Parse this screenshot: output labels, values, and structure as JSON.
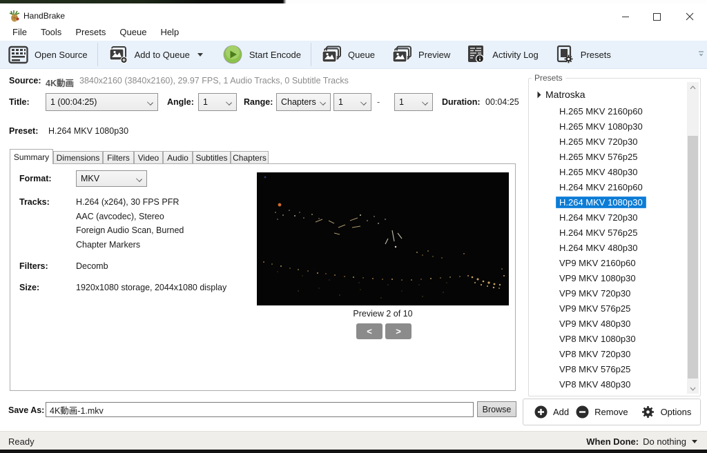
{
  "window": {
    "title": "HandBrake",
    "minimize": "minimize",
    "maximize": "maximize",
    "close": "close"
  },
  "menu": {
    "items": [
      {
        "label": "File"
      },
      {
        "label": "Tools"
      },
      {
        "label": "Presets"
      },
      {
        "label": "Queue"
      },
      {
        "label": "Help"
      }
    ]
  },
  "toolbar": {
    "open_source": "Open Source",
    "add_to_queue": "Add to Queue",
    "start_encode": "Start Encode",
    "queue": "Queue",
    "preview": "Preview",
    "activity_log": "Activity Log",
    "presets": "Presets"
  },
  "source_row": {
    "label": "Source:",
    "name": "4K動画",
    "details": "3840x2160 (3840x2160), 29.97 FPS, 1 Audio Tracks, 0 Subtitle Tracks"
  },
  "title_row": {
    "title_label": "Title:",
    "title_value": "1 (00:04:25)",
    "angle_label": "Angle:",
    "angle_value": "1",
    "range_label": "Range:",
    "range_type": "Chapters",
    "range_from": "1",
    "range_dash": "-",
    "range_to": "1",
    "duration_label": "Duration:",
    "duration_value": "00:04:25"
  },
  "preset_row": {
    "label": "Preset:",
    "value": "H.264 MKV 1080p30"
  },
  "tabs": [
    {
      "label": "Summary"
    },
    {
      "label": "Dimensions"
    },
    {
      "label": "Filters"
    },
    {
      "label": "Video"
    },
    {
      "label": "Audio"
    },
    {
      "label": "Subtitles"
    },
    {
      "label": "Chapters"
    }
  ],
  "summary": {
    "format_label": "Format:",
    "format_value": "MKV",
    "tracks_label": "Tracks:",
    "tracks": [
      "H.264 (x264), 30 FPS PFR",
      "AAC (avcodec), Stereo",
      "Foreign Audio Scan, Burned",
      "Chapter Markers"
    ],
    "filters_label": "Filters:",
    "filters_value": "Decomb",
    "size_label": "Size:",
    "size_value": "1920x1080 storage, 2044x1080 display"
  },
  "preview_area": {
    "caption": "Preview 2 of 10",
    "prev": "<",
    "next": ">"
  },
  "save_as": {
    "label": "Save As:",
    "value": "4K動画-1.mkv",
    "browse": "Browse"
  },
  "presets_panel": {
    "title": "Presets",
    "group": "Matroska",
    "items": [
      {
        "label": "H.265 MKV 2160p60"
      },
      {
        "label": "H.265 MKV 1080p30"
      },
      {
        "label": "H.265 MKV 720p30"
      },
      {
        "label": "H.265 MKV 576p25"
      },
      {
        "label": "H.265 MKV 480p30"
      },
      {
        "label": "H.264 MKV 2160p60"
      },
      {
        "label": "H.264 MKV 1080p30",
        "selected": true
      },
      {
        "label": "H.264 MKV 720p30"
      },
      {
        "label": "H.264 MKV 576p25"
      },
      {
        "label": "H.264 MKV 480p30"
      },
      {
        "label": "VP9 MKV 2160p60"
      },
      {
        "label": "VP9 MKV 1080p30"
      },
      {
        "label": "VP9 MKV 720p30"
      },
      {
        "label": "VP9 MKV 576p25"
      },
      {
        "label": "VP9 MKV 480p30"
      },
      {
        "label": "VP8 MKV 1080p30"
      },
      {
        "label": "VP8 MKV 720p30"
      },
      {
        "label": "VP8 MKV 576p25"
      },
      {
        "label": "VP8 MKV 480p30"
      }
    ],
    "add": "Add",
    "remove": "Remove",
    "options": "Options"
  },
  "status_bar": {
    "ready": "Ready",
    "when_done_label": "When Done:",
    "when_done_value": "Do nothing"
  },
  "colors": {
    "accent": "#0c7cd6",
    "toolbar_bg": "#e9f2fb",
    "encode_green": "#8bc34a",
    "selection_text": "#ffffff"
  }
}
